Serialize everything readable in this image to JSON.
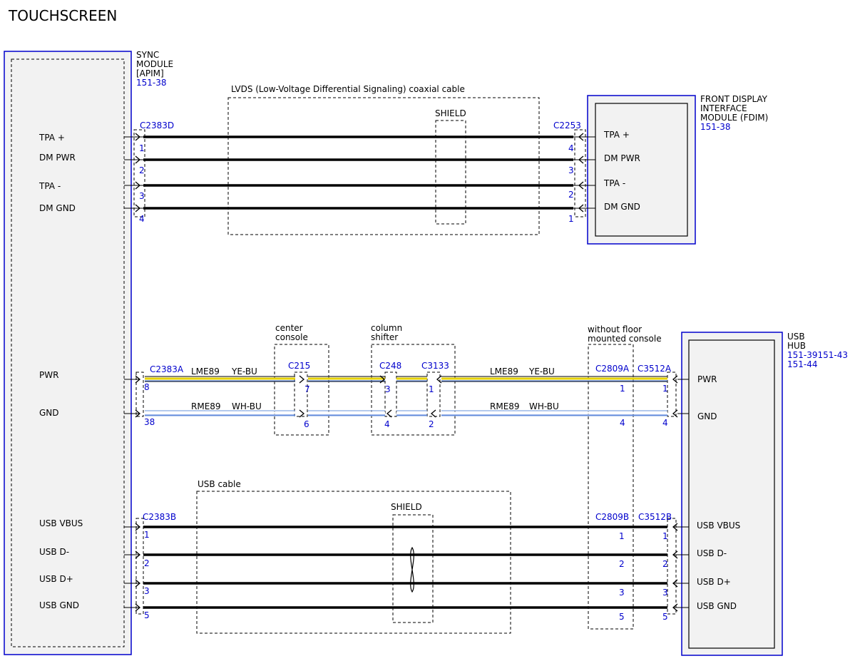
{
  "title": "TOUCHSCREEN",
  "colors": {
    "blue": "#0000cc",
    "module_fill": "#f2f2f2",
    "yellow": "#e6d200",
    "light_blue": "#88a9e0",
    "bu": "#3f6fd8"
  },
  "modules": {
    "sync": {
      "line1": "SYNC",
      "line2": "MODULE",
      "line3": "[APIM]",
      "ref": "151-38"
    },
    "fdim": {
      "line1": "FRONT DISPLAY",
      "line2": "INTERFACE",
      "line3": "MODULE (FDIM)",
      "ref": "151-38"
    },
    "usbhub": {
      "line1": "USB",
      "line2": "HUB",
      "ref1": "151-39151-43",
      "ref2": "151-44"
    }
  },
  "cables": {
    "lvds": "LVDS (Low-Voltage Differential Signaling) coaxial cable",
    "lvds_shield": "SHIELD",
    "center_console": [
      "center",
      "console"
    ],
    "column_shifter": [
      "column",
      "shifter"
    ],
    "floor_console": [
      "without floor",
      "mounted console"
    ],
    "usb": "USB cable",
    "usb_shield": "SHIELD"
  },
  "connectors": {
    "c2383d": "C2383D",
    "c2253": "C2253",
    "c2383a": "C2383A",
    "c215": "C215",
    "c248": "C248",
    "c3133": "C3133",
    "c2809a": "C2809A",
    "c3512a": "C3512A",
    "c2383b": "C2383B",
    "c2809b": "C2809B",
    "c3512b": "C3512B"
  },
  "lvds_rows": [
    {
      "left": "TPA +",
      "right": "TPA +",
      "pin_l": "1",
      "pin_r": "4"
    },
    {
      "left": "DM PWR",
      "right": "DM PWR",
      "pin_l": "2",
      "pin_r": "3"
    },
    {
      "left": "TPA -",
      "right": "TPA -",
      "pin_l": "3",
      "pin_r": "2"
    },
    {
      "left": "DM GND",
      "right": "DM GND",
      "pin_l": "4",
      "pin_r": "1"
    }
  ],
  "power_rows": [
    {
      "left": "PWR",
      "right": "PWR",
      "circuit": "LME89",
      "color": "YE-BU",
      "pins": [
        "8",
        "7",
        "3",
        "1",
        "1",
        "1"
      ]
    },
    {
      "left": "GND",
      "right": "GND",
      "circuit": "RME89",
      "color": "WH-BU",
      "pins": [
        "38",
        "6",
        "4",
        "2",
        "4",
        "4"
      ]
    }
  ],
  "usb_rows": [
    {
      "left": "USB VBUS",
      "right": "USB VBUS",
      "pin_l": "1",
      "pin_m": "1",
      "pin_r": "1"
    },
    {
      "left": "USB D-",
      "right": "USB D-",
      "pin_l": "2",
      "pin_m": "2",
      "pin_r": "2"
    },
    {
      "left": "USB D+",
      "right": "USB D+",
      "pin_l": "3",
      "pin_m": "3",
      "pin_r": "3"
    },
    {
      "left": "USB GND",
      "right": "USB GND",
      "pin_l": "5",
      "pin_m": "5",
      "pin_r": "5"
    }
  ]
}
